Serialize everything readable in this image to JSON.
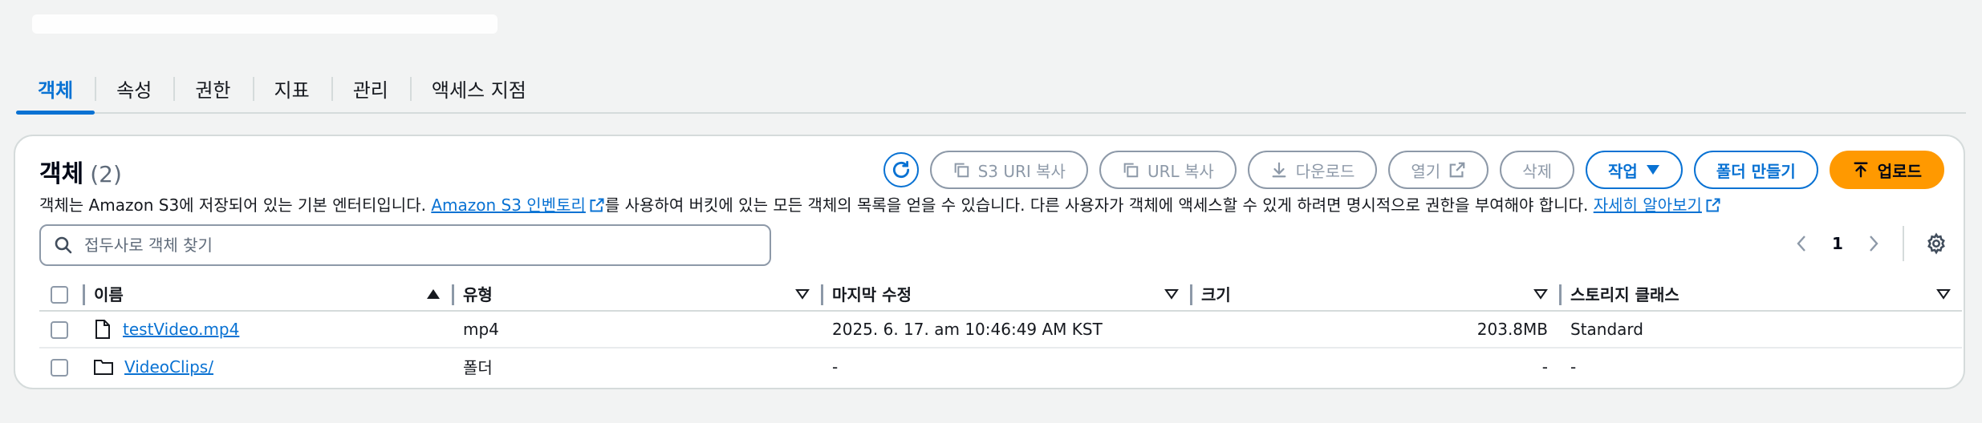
{
  "tabs": [
    {
      "label": "객체",
      "active": true
    },
    {
      "label": "속성"
    },
    {
      "label": "권한"
    },
    {
      "label": "지표"
    },
    {
      "label": "관리"
    },
    {
      "label": "액세스 지점"
    }
  ],
  "panel": {
    "title": "객체",
    "count": "(2)",
    "desc_prefix": "객체는 Amazon S3에 저장되어 있는 기본 엔터티입니다. ",
    "desc_link1": "Amazon S3 인벤토리",
    "desc_middle": "를 사용하여 버킷에 있는 모든 객체의 목록을 얻을 수 있습니다. 다른 사용자가 객체에 액세스할 수 있게 하려면 명시적으로 권한을 부여해야 합니다. ",
    "desc_link2": "자세히 알아보기"
  },
  "actions": {
    "copy_s3_uri": "S3 URI 복사",
    "copy_url": "URL 복사",
    "download": "다운로드",
    "open": "열기",
    "delete": "삭제",
    "actions_menu": "작업",
    "create_folder": "폴더 만들기",
    "upload": "업로드"
  },
  "search": {
    "placeholder": "접두사로 객체 찾기"
  },
  "pager": {
    "page": "1"
  },
  "table": {
    "columns": [
      "이름",
      "유형",
      "마지막 수정",
      "크기",
      "스토리지 클래스"
    ],
    "rows": [
      {
        "name": "testVideo.mp4",
        "type": "mp4",
        "modified": "2025. 6. 17. am 10:46:49 AM KST",
        "size": "203.8MB",
        "storage": "Standard",
        "icon": "file-icon"
      },
      {
        "name": "VideoClips/",
        "type": "폴더",
        "modified": "-",
        "size": "-",
        "storage": "-",
        "icon": "folder-icon"
      }
    ]
  },
  "colors": {
    "accent": "#0972d3",
    "primary": "#ff9900",
    "disabled": "#8d99a8"
  }
}
